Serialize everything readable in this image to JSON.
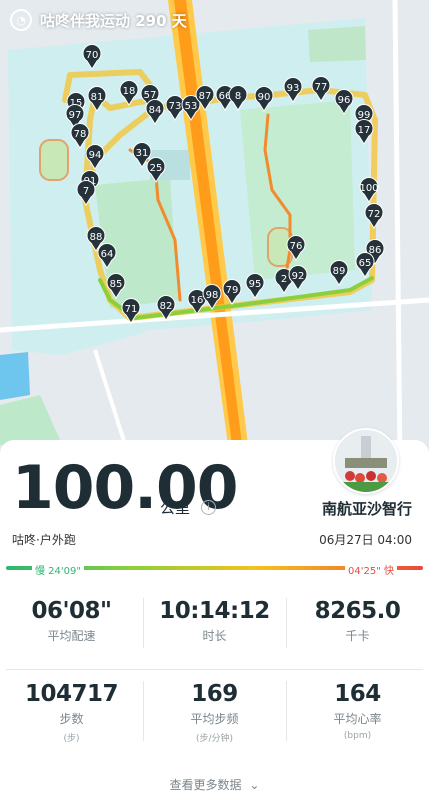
{
  "banner": {
    "logo_text": "咕咚",
    "text": "咕咚伴我运动 290 天"
  },
  "map": {
    "route_markers": [
      "70",
      "81",
      "15",
      "97",
      "18",
      "57",
      "84",
      "73",
      "53",
      "87",
      "66",
      "8",
      "90",
      "93",
      "77",
      "96",
      "99",
      "17",
      "78",
      "94",
      "31",
      "25",
      "91",
      "7",
      "100",
      "72",
      "88",
      "64",
      "86",
      "65",
      "85",
      "71",
      "82",
      "16",
      "98",
      "79",
      "95",
      "2",
      "92",
      "76",
      "89"
    ]
  },
  "summary": {
    "distance": "100.00",
    "unit": "公里",
    "info_icon": "i",
    "user_name": "南航亚沙智行",
    "activity_type": "咕咚·户外跑",
    "datetime": "06月27日 04:00",
    "pace_slow": "慢 24'09\"",
    "pace_fast": "04'25\" 快",
    "colors": {
      "slow": "#2bb673",
      "fast": "#e8493b"
    }
  },
  "stats": [
    {
      "value": "06'08\"",
      "label": "平均配速",
      "unit": ""
    },
    {
      "value": "10:14:12",
      "label": "时长",
      "unit": ""
    },
    {
      "value": "8265.0",
      "label": "千卡",
      "unit": ""
    },
    {
      "value": "104717",
      "label": "步数",
      "unit": "(步)"
    },
    {
      "value": "169",
      "label": "平均步频",
      "unit": "(步/分钟)"
    },
    {
      "value": "164",
      "label": "平均心率",
      "unit": "(bpm)"
    }
  ],
  "more_link": "查看更多数据"
}
